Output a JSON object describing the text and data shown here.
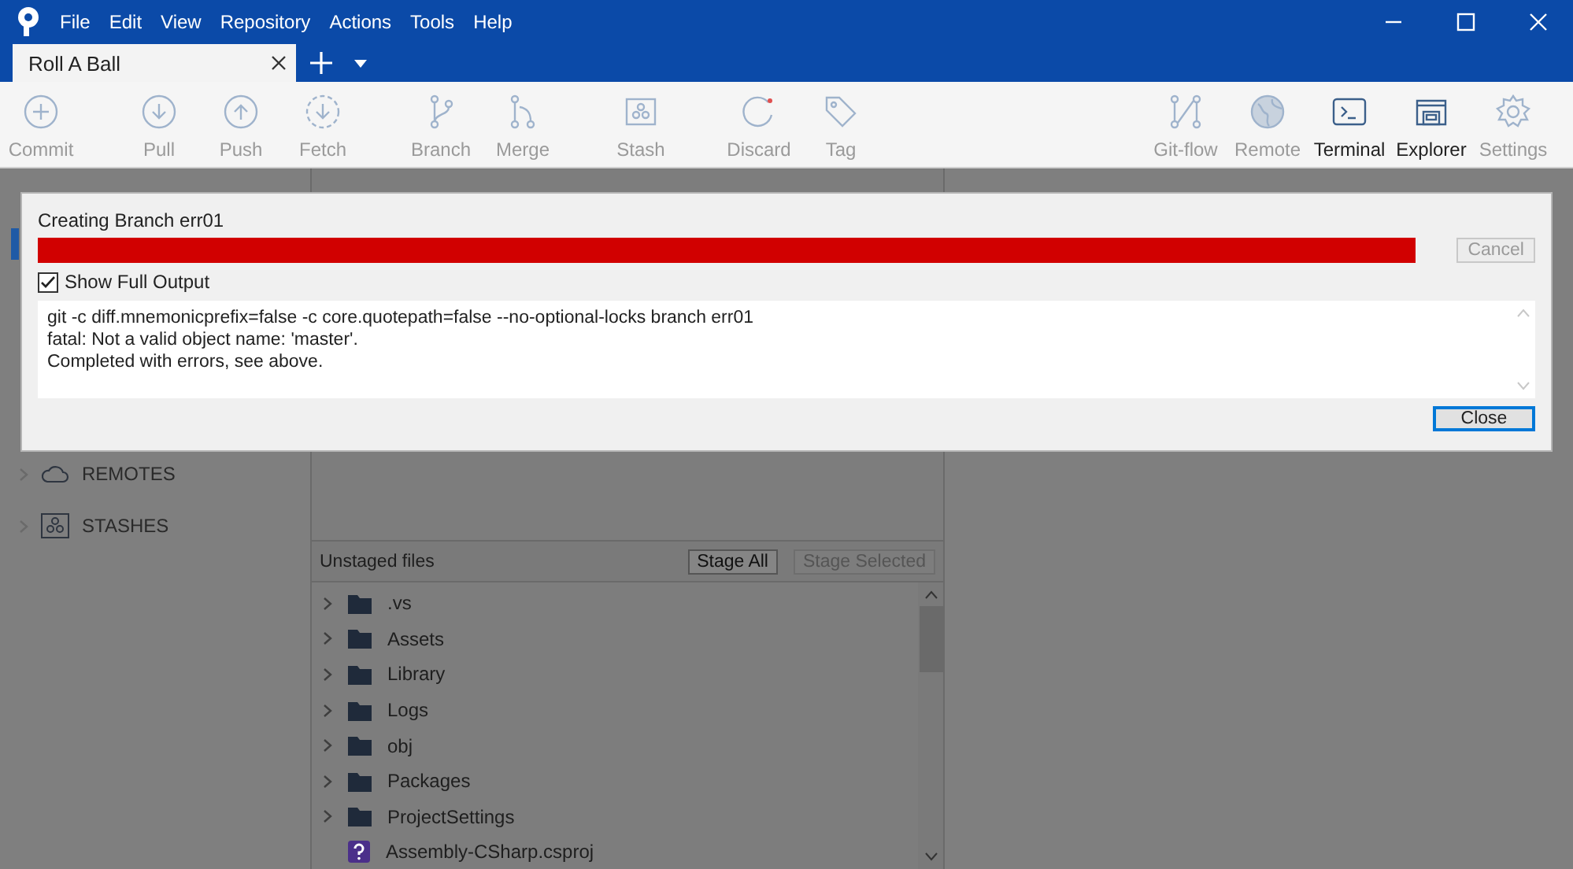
{
  "menu": [
    "File",
    "Edit",
    "View",
    "Repository",
    "Actions",
    "Tools",
    "Help"
  ],
  "tabs": [
    {
      "label": "Roll A Ball",
      "selected": true
    }
  ],
  "toolbar": [
    {
      "label": "Commit",
      "disabled": true,
      "group_start": false
    },
    {
      "label": "Pull",
      "disabled": true,
      "group_start": true
    },
    {
      "label": "Push",
      "disabled": true,
      "group_start": false
    },
    {
      "label": "Fetch",
      "disabled": true,
      "group_start": false
    },
    {
      "label": "Branch",
      "disabled": true,
      "group_start": true
    },
    {
      "label": "Merge",
      "disabled": true,
      "group_start": false
    },
    {
      "label": "Stash",
      "disabled": true,
      "group_start": true
    },
    {
      "label": "Discard",
      "disabled": true,
      "group_start": true
    },
    {
      "label": "Tag",
      "disabled": true,
      "group_start": false
    }
  ],
  "toolbar_right": [
    {
      "label": "Git-flow",
      "disabled": true
    },
    {
      "label": "Remote",
      "disabled": true
    },
    {
      "label": "Terminal",
      "disabled": false
    },
    {
      "label": "Explorer",
      "disabled": false
    },
    {
      "label": "Settings",
      "disabled": true
    }
  ],
  "sidebar": {
    "sections": [
      {
        "label": "REMOTES",
        "expanded": false
      },
      {
        "label": "STASHES",
        "expanded": false
      }
    ]
  },
  "unstaged": {
    "title": "Unstaged files",
    "buttons": [
      {
        "label": "Stage All",
        "disabled": false
      },
      {
        "label": "Stage Selected",
        "disabled": true
      }
    ],
    "files": [
      {
        "name": ".vs",
        "kind": "folder"
      },
      {
        "name": "Assets",
        "kind": "folder"
      },
      {
        "name": "Library",
        "kind": "folder"
      },
      {
        "name": "Logs",
        "kind": "folder"
      },
      {
        "name": "obj",
        "kind": "folder"
      },
      {
        "name": "Packages",
        "kind": "folder"
      },
      {
        "name": "ProjectSettings",
        "kind": "folder"
      },
      {
        "name": "Assembly-CSharp.csproj",
        "kind": "untracked"
      }
    ]
  },
  "dialog": {
    "title": "Creating Branch  err01",
    "progress": {
      "level": 1,
      "error": true
    },
    "cancel": {
      "label": "Cancel",
      "disabled": true
    },
    "show_full_output": {
      "label": "Show Full Output",
      "checked": true
    },
    "output": [
      "git -c diff.mnemonicprefix=false -c core.quotepath=false --no-optional-locks branch err01",
      "fatal: Not a valid object name: 'master'.",
      "Completed with errors, see above."
    ],
    "close": {
      "label": "Close",
      "disabled": false
    }
  }
}
